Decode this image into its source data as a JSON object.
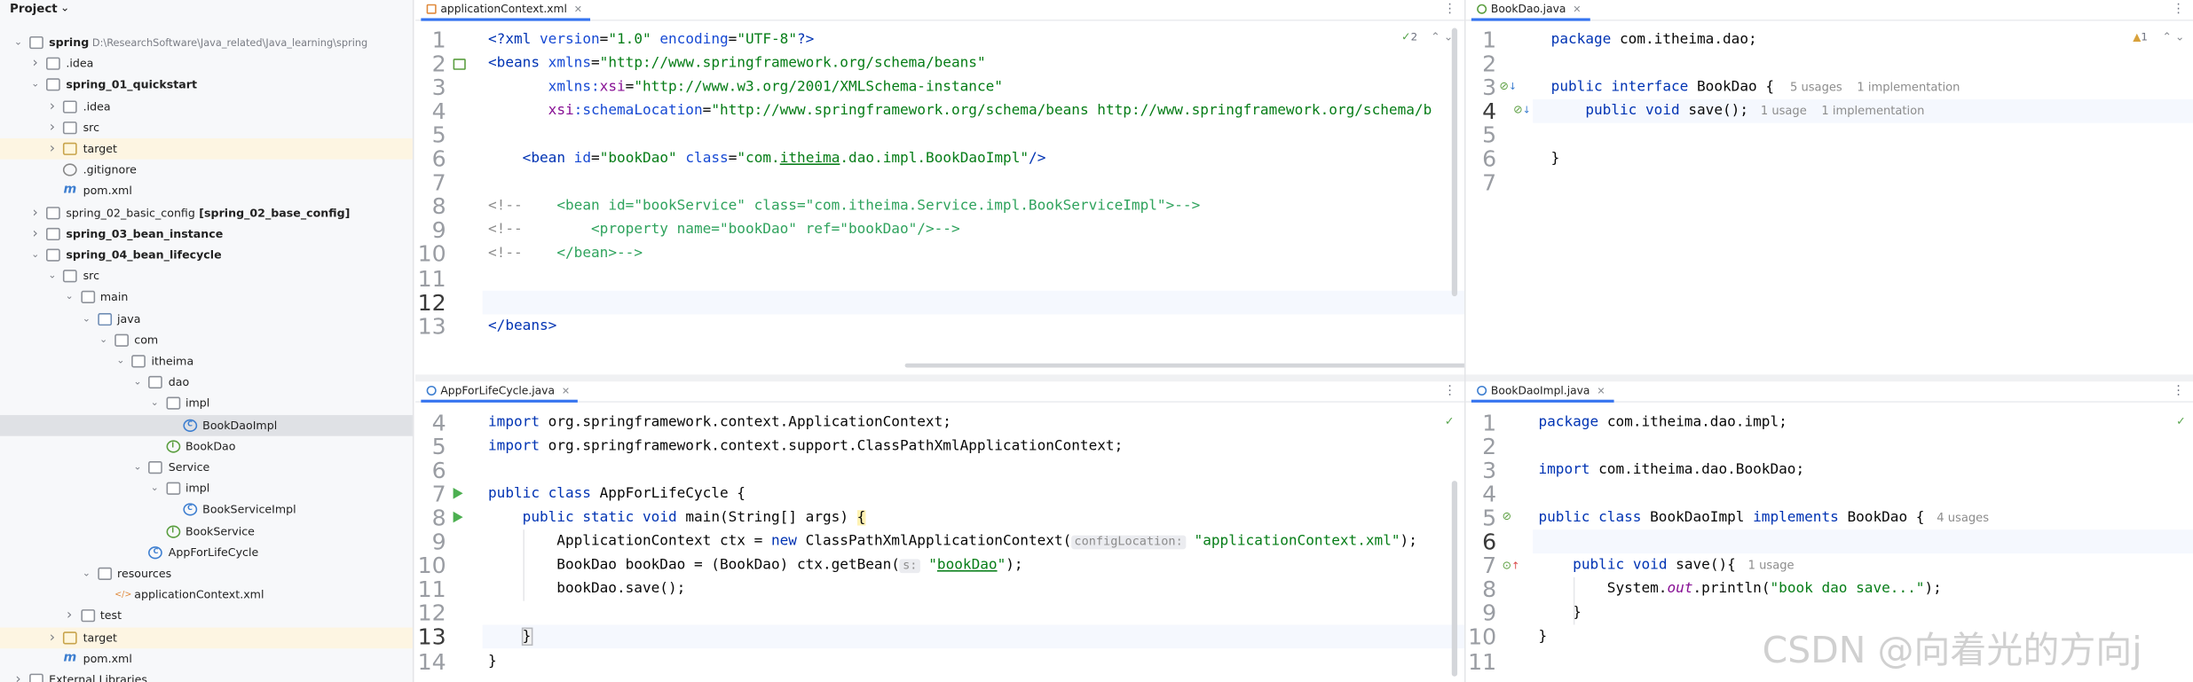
{
  "sidebar": {
    "title": "Project",
    "tree": [
      {
        "label": "spring",
        "bold": true,
        "extra": "D:\\ResearchSoftware\\Java_related\\Java_learning\\spring",
        "depth": 0,
        "arrow": "v",
        "icon": "module"
      },
      {
        "label": ".idea",
        "depth": 1,
        "arrow": ">",
        "icon": "folder"
      },
      {
        "label": "spring_01_quickstart",
        "bold": true,
        "depth": 1,
        "arrow": "v",
        "icon": "module"
      },
      {
        "label": ".idea",
        "depth": 2,
        "arrow": ">",
        "icon": "folder"
      },
      {
        "label": "src",
        "depth": 2,
        "arrow": ">",
        "icon": "folder"
      },
      {
        "label": "target",
        "depth": 2,
        "arrow": ">",
        "icon": "target",
        "highlight": "yellow"
      },
      {
        "label": ".gitignore",
        "depth": 2,
        "icon": "gitignore"
      },
      {
        "label": "pom.xml",
        "depth": 2,
        "icon": "maven"
      },
      {
        "label": "spring_02_basic_config",
        "extra_bold": "[spring_02_base_config]",
        "depth": 1,
        "arrow": ">",
        "icon": "module"
      },
      {
        "label": "spring_03_bean_instance",
        "bold": true,
        "depth": 1,
        "arrow": ">",
        "icon": "module"
      },
      {
        "label": "spring_04_bean_lifecycle",
        "bold": true,
        "depth": 1,
        "arrow": "v",
        "icon": "module"
      },
      {
        "label": "src",
        "depth": 2,
        "arrow": "v",
        "icon": "folder"
      },
      {
        "label": "main",
        "depth": 3,
        "arrow": "v",
        "icon": "folder"
      },
      {
        "label": "java",
        "depth": 4,
        "arrow": "v",
        "icon": "source-folder"
      },
      {
        "label": "com",
        "depth": 5,
        "arrow": "v",
        "icon": "package"
      },
      {
        "label": "itheima",
        "depth": 6,
        "arrow": "v",
        "icon": "package"
      },
      {
        "label": "dao",
        "depth": 7,
        "arrow": "v",
        "icon": "package"
      },
      {
        "label": "impl",
        "depth": 8,
        "arrow": "v",
        "icon": "package"
      },
      {
        "label": "BookDaoImpl",
        "depth": 9,
        "icon": "class",
        "highlight": "selected"
      },
      {
        "label": "BookDao",
        "depth": 8,
        "icon": "interface"
      },
      {
        "label": "Service",
        "depth": 7,
        "arrow": "v",
        "icon": "package"
      },
      {
        "label": "impl",
        "depth": 8,
        "arrow": "v",
        "icon": "package"
      },
      {
        "label": "BookServiceImpl",
        "depth": 9,
        "icon": "class"
      },
      {
        "label": "BookService",
        "depth": 8,
        "icon": "interface"
      },
      {
        "label": "AppForLifeCycle",
        "depth": 7,
        "icon": "class"
      },
      {
        "label": "resources",
        "depth": 4,
        "arrow": "v",
        "icon": "resources"
      },
      {
        "label": "applicationContext.xml",
        "depth": 5,
        "icon": "xml"
      },
      {
        "label": "test",
        "depth": 3,
        "arrow": ">",
        "icon": "folder"
      },
      {
        "label": "target",
        "depth": 2,
        "arrow": ">",
        "icon": "target",
        "highlight": "yellow"
      },
      {
        "label": "pom.xml",
        "depth": 2,
        "icon": "maven"
      },
      {
        "label": "External Libraries",
        "depth": 0,
        "arrow": ">",
        "icon": "library"
      }
    ]
  },
  "editors": {
    "xml": {
      "tab": "applicationContext.xml",
      "inspection": "2",
      "lines": [
        {
          "n": "1",
          "segs": [
            [
              "tag",
              "<?xml "
            ],
            [
              "attr",
              "version"
            ],
            [
              "",
              "="
            ],
            [
              "str",
              "\"1.0\""
            ],
            [
              "",
              ""
            ],
            [
              "attr",
              " encoding"
            ],
            [
              "",
              "="
            ],
            [
              "str",
              "\"UTF-8\""
            ],
            [
              "tag",
              "?>"
            ]
          ]
        },
        {
          "n": "2",
          "segs": [
            [
              "tag",
              "<beans "
            ],
            [
              "attr",
              "xmlns"
            ],
            [
              "",
              "="
            ],
            [
              "str",
              "\"http://www.springframework.org/schema/beans\""
            ]
          ]
        },
        {
          "n": "3",
          "segs": [
            [
              "",
              "       "
            ],
            [
              "attr",
              "xmlns:"
            ],
            [
              "ns",
              "xsi"
            ],
            [
              "",
              "="
            ],
            [
              "str",
              "\"http://www.w3.org/2001/XMLSchema-instance\""
            ]
          ]
        },
        {
          "n": "4",
          "segs": [
            [
              "",
              "       "
            ],
            [
              "ns",
              "xsi"
            ],
            [
              "attr",
              ":schemaLocation"
            ],
            [
              "",
              "="
            ],
            [
              "str",
              "\"http://www.springframework.org/schema/beans http://www.springframework.org/schema/b"
            ]
          ]
        },
        {
          "n": "5",
          "segs": []
        },
        {
          "n": "6",
          "segs": [
            [
              "",
              "    "
            ],
            [
              "tag",
              "<bean "
            ],
            [
              "attr",
              "id"
            ],
            [
              "",
              "="
            ],
            [
              "str",
              "\"bookDao\""
            ],
            [
              "attr",
              " class"
            ],
            [
              "",
              "="
            ],
            [
              "str",
              "\"com."
            ],
            [
              "stru",
              "itheima"
            ],
            [
              "str",
              ".dao.impl.BookDaoImpl\""
            ],
            [
              "tag",
              "/>"
            ]
          ]
        },
        {
          "n": "7",
          "segs": []
        },
        {
          "n": "8",
          "segs": [
            [
              "cmt",
              "<!--    "
            ],
            [
              "cmtt",
              "<bean id=\"bookService\" class=\"com.itheima.Service.impl.BookServiceImpl\">-->"
            ]
          ]
        },
        {
          "n": "9",
          "segs": [
            [
              "cmt",
              "<!--        "
            ],
            [
              "cmtt",
              "<property name=\"bookDao\" ref=\"bookDao\"/>-->"
            ]
          ]
        },
        {
          "n": "10",
          "segs": [
            [
              "cmt",
              "<!--    "
            ],
            [
              "cmtt",
              "</bean>-->"
            ]
          ]
        },
        {
          "n": "11",
          "segs": []
        },
        {
          "n": "12",
          "segs": []
        },
        {
          "n": "13",
          "segs": [
            [
              "tag",
              "</beans>"
            ]
          ]
        }
      ]
    },
    "bookdao": {
      "tab": "BookDao.java",
      "warnings": "1",
      "lines": [
        {
          "n": "1",
          "segs": [
            [
              "kw",
              "package "
            ],
            [
              "",
              "com.itheima.dao;"
            ]
          ]
        },
        {
          "n": "2",
          "segs": []
        },
        {
          "n": "3",
          "segs": [
            [
              "kw",
              "public interface "
            ],
            [
              "",
              "BookDao { "
            ],
            [
              "hint",
              "  5 usages    1 implementation"
            ]
          ]
        },
        {
          "n": "4",
          "segs": [
            [
              "",
              "    "
            ],
            [
              "kw",
              "public void "
            ],
            [
              "",
              "save(); "
            ],
            [
              "hint",
              " 1 usage    1 implementation"
            ]
          ]
        },
        {
          "n": "5",
          "segs": []
        },
        {
          "n": "6",
          "segs": [
            [
              "",
              "}"
            ]
          ]
        },
        {
          "n": "7",
          "segs": []
        }
      ]
    },
    "app": {
      "tab": "AppForLifeCycle.java",
      "lines": [
        {
          "n": "4",
          "segs": [
            [
              "kw",
              "import "
            ],
            [
              "",
              "org.springframework.context.ApplicationContext;"
            ]
          ]
        },
        {
          "n": "5",
          "segs": [
            [
              "kw",
              "import "
            ],
            [
              "",
              "org.springframework.context.support.ClassPathXmlApplicationContext;"
            ]
          ]
        },
        {
          "n": "6",
          "segs": []
        },
        {
          "n": "7",
          "segs": [
            [
              "kw",
              "public class "
            ],
            [
              "",
              "AppForLifeCycle {"
            ]
          ]
        },
        {
          "n": "8",
          "segs": [
            [
              "",
              "    "
            ],
            [
              "kw",
              "public static void "
            ],
            [
              "",
              "main(String[] args) "
            ],
            [
              "brace",
              "{"
            ]
          ]
        },
        {
          "n": "9",
          "segs": [
            [
              "",
              "        ApplicationContext ctx = "
            ],
            [
              "kw",
              "new "
            ],
            [
              "",
              "ClassPathXmlApplicationContext("
            ],
            [
              "inlay",
              "configLocation:"
            ],
            [
              "str",
              " \"applicationContext.xml\""
            ],
            [
              "",
              ");"
            ]
          ]
        },
        {
          "n": "10",
          "segs": [
            [
              "",
              "        BookDao bookDao = (BookDao) ctx.getBean("
            ],
            [
              "inlay",
              "s:"
            ],
            [
              "str",
              " \""
            ],
            [
              "stru",
              "bookDao"
            ],
            [
              "str",
              "\""
            ],
            [
              "",
              ");"
            ]
          ]
        },
        {
          "n": "11",
          "segs": [
            [
              "",
              "        bookDao.save();"
            ]
          ]
        },
        {
          "n": "12",
          "segs": []
        },
        {
          "n": "13",
          "segs": [
            [
              "",
              "    "
            ],
            [
              "bracehl",
              "}"
            ]
          ]
        },
        {
          "n": "14",
          "segs": [
            [
              "",
              "}"
            ]
          ]
        }
      ]
    },
    "impl": {
      "tab": "BookDaoImpl.java",
      "lines": [
        {
          "n": "1",
          "segs": [
            [
              "kw",
              "package "
            ],
            [
              "",
              "com.itheima.dao.impl;"
            ]
          ]
        },
        {
          "n": "2",
          "segs": []
        },
        {
          "n": "3",
          "segs": [
            [
              "kw",
              "import "
            ],
            [
              "",
              "com.itheima.dao.BookDao;"
            ]
          ]
        },
        {
          "n": "4",
          "segs": []
        },
        {
          "n": "5",
          "segs": [
            [
              "kw",
              "public class "
            ],
            [
              "",
              "BookDaoImpl "
            ],
            [
              "kw",
              "implements "
            ],
            [
              "",
              "BookDao { "
            ],
            [
              "hint",
              " 4 usages"
            ]
          ]
        },
        {
          "n": "6",
          "segs": []
        },
        {
          "n": "7",
          "segs": [
            [
              "",
              "    "
            ],
            [
              "kw",
              "public void "
            ],
            [
              "",
              "save(){ "
            ],
            [
              "hint",
              " 1 usage"
            ]
          ]
        },
        {
          "n": "8",
          "segs": [
            [
              "",
              "        System."
            ],
            [
              "fld",
              "out"
            ],
            [
              "",
              ".println("
            ],
            [
              "str",
              "\"book dao save...\""
            ],
            [
              "",
              ");"
            ]
          ]
        },
        {
          "n": "9",
          "segs": [
            [
              "",
              "    }"
            ]
          ]
        },
        {
          "n": "10",
          "segs": [
            [
              "",
              "}"
            ]
          ]
        },
        {
          "n": "11",
          "segs": []
        }
      ]
    }
  },
  "watermark": "CSDN @向着光的方向j",
  "colors": {
    "keyword": "#0033b3",
    "string": "#067d17",
    "comment": "#8c8c8c",
    "accent": "#3574f0"
  }
}
